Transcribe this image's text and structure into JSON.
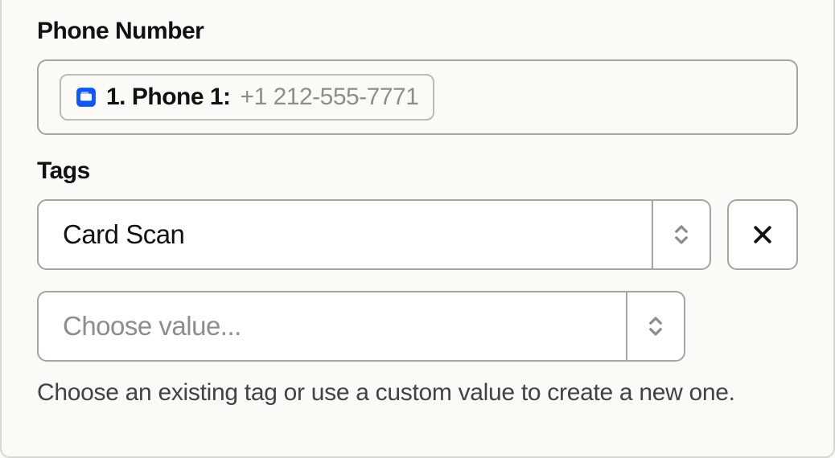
{
  "phone": {
    "label": "Phone Number",
    "token_text": "1. Phone 1:",
    "token_value": "+1 212-555-7771"
  },
  "tags": {
    "label": "Tags",
    "selected": "Card Scan",
    "placeholder": "Choose value...",
    "hint": "Choose an existing tag or use a custom value to create a new one."
  }
}
